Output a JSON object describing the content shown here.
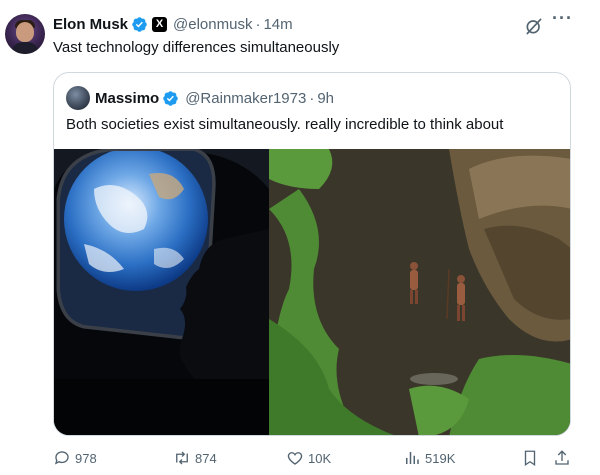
{
  "tweet": {
    "author_name": "Elon Musk",
    "handle": "@elonmusk",
    "separator": "·",
    "time": "14m",
    "x_badge": "X",
    "text": "Vast technology differences simultaneously",
    "verified_color": "#1d9bf0",
    "more_label": "···"
  },
  "quote": {
    "author_name": "Massimo",
    "handle": "@Rainmaker1973",
    "separator": "·",
    "time": "9h",
    "text": "Both societies exist simultaneously. really incredible to think about",
    "media": [
      {
        "description_icon": "earth-window-photo-icon"
      },
      {
        "description_icon": "tribe-aerial-photo-icon"
      }
    ]
  },
  "actions": {
    "replies": "978",
    "reposts": "874",
    "likes": "10K",
    "views": "519K"
  },
  "colors": {
    "text_primary": "#0f1419",
    "text_secondary": "#536471",
    "border": "#cfd9de",
    "accent": "#1d9bf0"
  }
}
